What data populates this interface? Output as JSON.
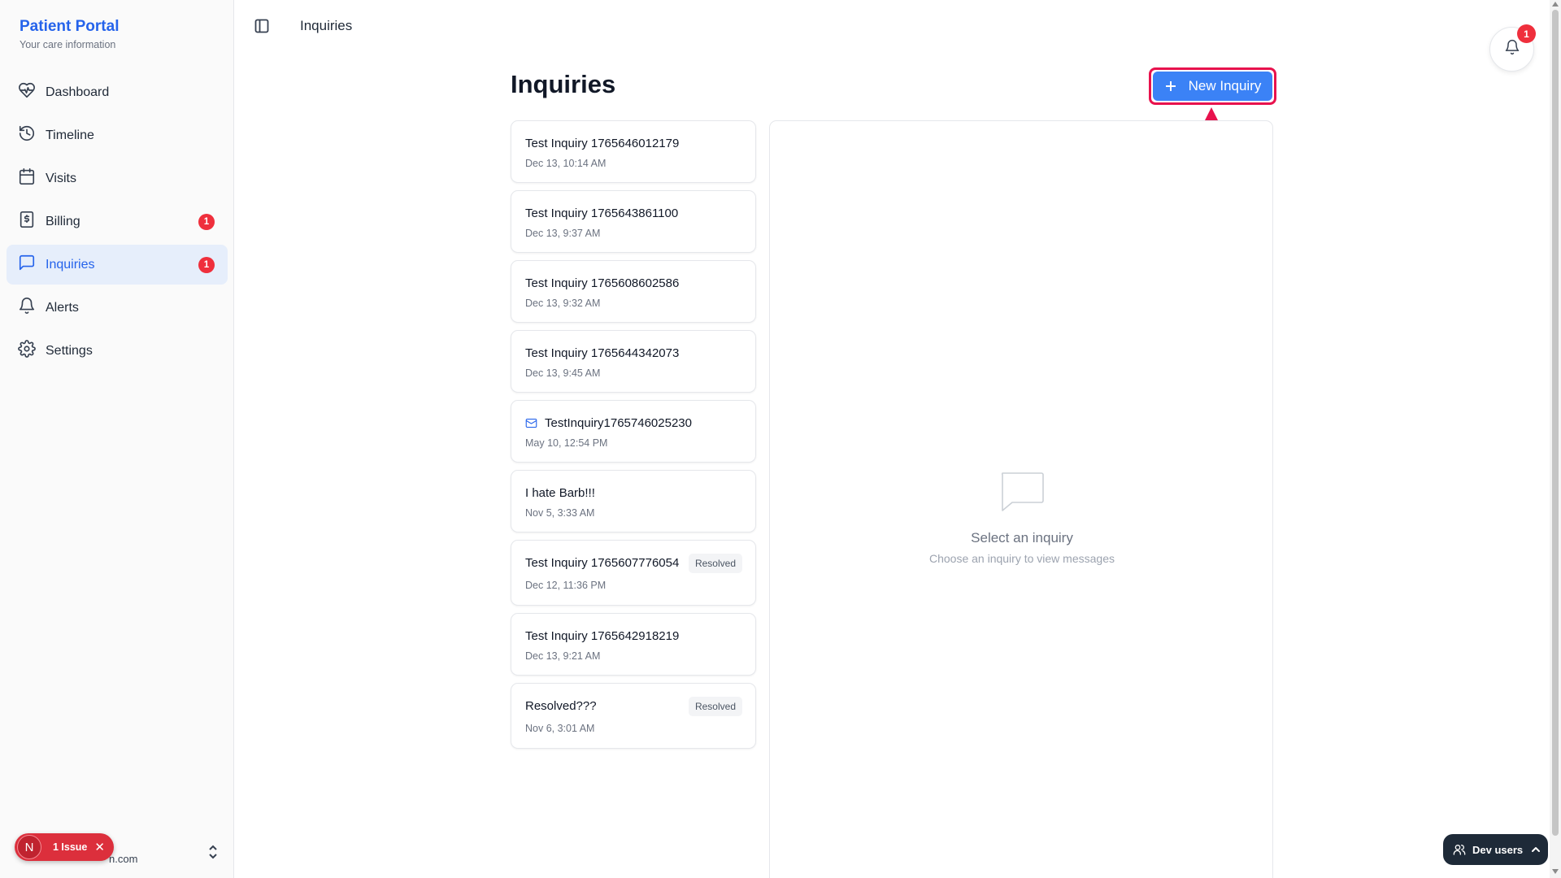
{
  "brand": {
    "title": "Patient Portal",
    "subtitle": "Your care information"
  },
  "nav": {
    "items": [
      {
        "label": "Dashboard",
        "icon": "heart-pulse-icon",
        "badge": ""
      },
      {
        "label": "Timeline",
        "icon": "history-icon",
        "badge": ""
      },
      {
        "label": "Visits",
        "icon": "calendar-icon",
        "badge": ""
      },
      {
        "label": "Billing",
        "icon": "dollar-receipt-icon",
        "badge": "1"
      },
      {
        "label": "Inquiries",
        "icon": "message-square-icon",
        "badge": "1",
        "active": true
      },
      {
        "label": "Alerts",
        "icon": "bell-icon",
        "badge": ""
      },
      {
        "label": "Settings",
        "icon": "gear-icon",
        "badge": ""
      }
    ]
  },
  "user": {
    "email": "n.com"
  },
  "issue_pill": {
    "avatar": "N",
    "label": "1 Issue",
    "close": "✕"
  },
  "topbar": {
    "title": "Inquiries",
    "notification_count": "1"
  },
  "main": {
    "title": "Inquiries",
    "new_button_label": "New Inquiry",
    "inquiries": [
      {
        "title": "Test Inquiry 1765646012179",
        "date": "Dec 13, 10:14 AM",
        "status": ""
      },
      {
        "title": "Test Inquiry 1765643861100",
        "date": "Dec 13, 9:37 AM",
        "status": ""
      },
      {
        "title": "Test Inquiry 1765608602586",
        "date": "Dec 13, 9:32 AM",
        "status": ""
      },
      {
        "title": "Test Inquiry 1765644342073",
        "date": "Dec 13, 9:45 AM",
        "status": ""
      },
      {
        "title": "TestInquiry1765746025230",
        "date": "May 10, 12:54 PM",
        "status": "",
        "icon": "mail-icon"
      },
      {
        "title": "I hate Barb!!!",
        "date": "Nov 5, 3:33 AM",
        "status": ""
      },
      {
        "title": "Test Inquiry 1765607776054",
        "date": "Dec 12, 11:36 PM",
        "status": "Resolved"
      },
      {
        "title": "Test Inquiry 1765642918219",
        "date": "Dec 13, 9:21 AM",
        "status": ""
      },
      {
        "title": "Resolved???",
        "date": "Nov 6, 3:01 AM",
        "status": "Resolved"
      }
    ],
    "empty_state": {
      "title": "Select an inquiry",
      "subtitle": "Choose an inquiry to view messages"
    }
  },
  "dev_users": {
    "label": "Dev users"
  },
  "colors": {
    "accent": "#2563eb",
    "button": "#3b82f6",
    "badge": "#ef2f3c",
    "highlight": "#e8124d"
  }
}
